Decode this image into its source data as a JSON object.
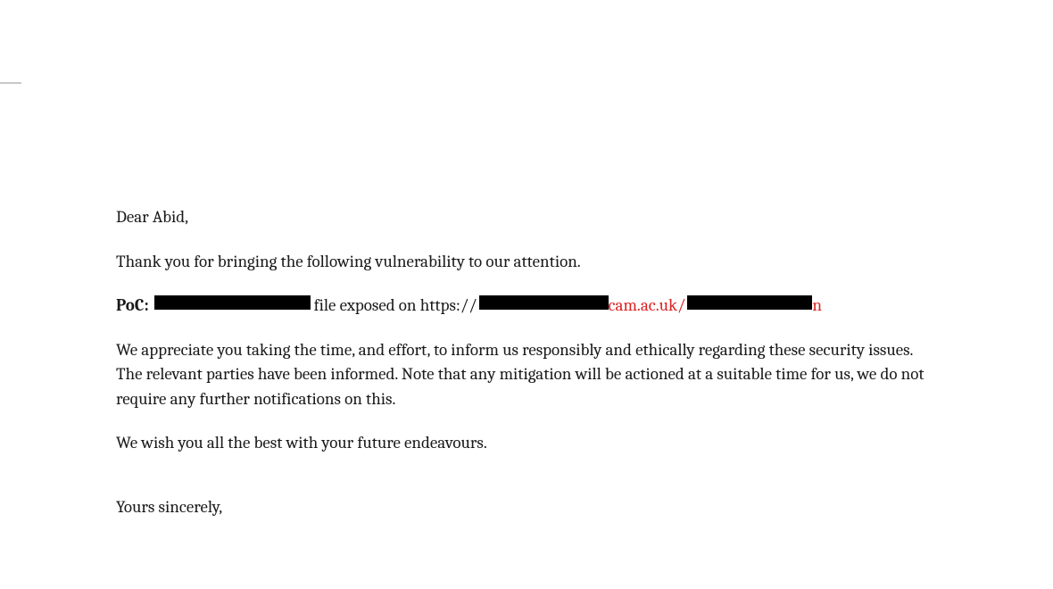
{
  "letter": {
    "salutation": "Dear Abid,",
    "intro": "Thank you for bringing the following vulnerability to our attention.",
    "poc": {
      "label": "PoC:",
      "middle_text": " file exposed on https://",
      "domain_visible": "cam.ac.uk/",
      "trailing_char": "n"
    },
    "body": "We appreciate you taking the time, and effort, to inform us responsibly and ethically regarding these security issues. The relevant parties have been informed. Note that any mitigation will be actioned at a suitable time for us, we do not require any further notifications on this.",
    "wish": "We wish you all the best with your future endeavours.",
    "closing": "Yours sincerely,"
  }
}
